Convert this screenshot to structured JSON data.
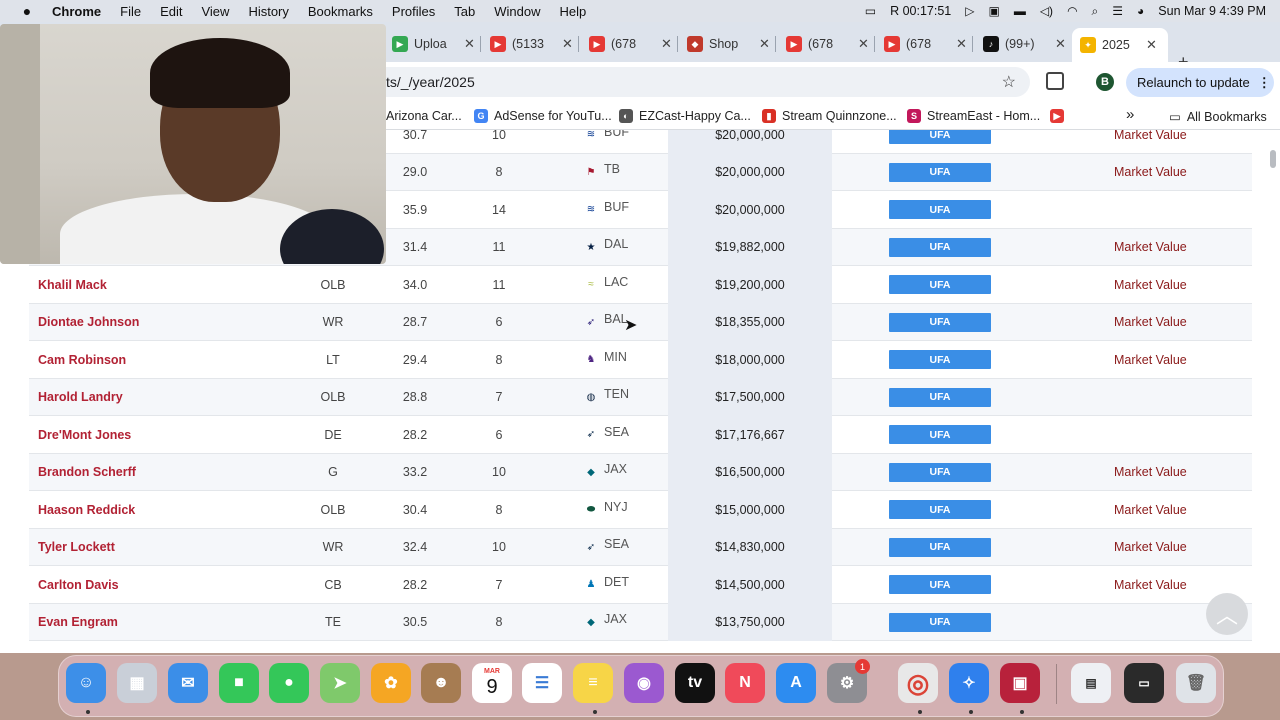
{
  "menubar": {
    "apple": "",
    "items": [
      "Chrome",
      "File",
      "Edit",
      "View",
      "History",
      "Bookmarks",
      "Profiles",
      "Tab",
      "Window",
      "Help"
    ],
    "recording": "R 00:17:51",
    "datetime": "Sun Mar 9  4:39 PM"
  },
  "tabs": [
    {
      "title": "Uploa",
      "favicon_color": "#34a853",
      "favicon": "▶"
    },
    {
      "title": "(5133",
      "favicon_color": "#e53935",
      "favicon": "▶"
    },
    {
      "title": "(678",
      "favicon_color": "#e53935",
      "favicon": "▶"
    },
    {
      "title": "Shop",
      "favicon_color": "#c0392b",
      "favicon": "◆"
    },
    {
      "title": "(678",
      "favicon_color": "#e53935",
      "favicon": "▶"
    },
    {
      "title": "(678",
      "favicon_color": "#e53935",
      "favicon": "▶"
    },
    {
      "title": "(99+)",
      "favicon_color": "#111111",
      "favicon": "♪"
    },
    {
      "title": "2025",
      "favicon_color": "#f4b400",
      "favicon": "✦",
      "active": true
    }
  ],
  "toolbar": {
    "url": "ts/_/year/2025",
    "relaunch_label": "Relaunch to update",
    "profile_initial": "B"
  },
  "bookmarks": [
    {
      "label": "Arizona Car...",
      "color": "#ffffff"
    },
    {
      "label": "AdSense for YouTu...",
      "color": "#4285f4",
      "glyph": "G"
    },
    {
      "label": "EZCast-Happy Ca...",
      "color": "#555555",
      "glyph": "◐"
    },
    {
      "label": "Stream Quinnzone...",
      "color": "#d93025",
      "glyph": "▮"
    },
    {
      "label": "StreamEast - Hom...",
      "color": "#c2185b",
      "glyph": "S"
    },
    {
      "label": "",
      "color": "#e53935",
      "glyph": "▶"
    }
  ],
  "bookmarks_overflow": "»",
  "all_bookmarks_label": "All Bookmarks",
  "table": {
    "rows": [
      {
        "name": "",
        "pos": "",
        "age": "30.7",
        "exp": "10",
        "team": "BUF",
        "team_glyph": "≋",
        "team_color": "#00338d",
        "salary": "$20,000,000",
        "status": "UFA",
        "note": "Market Value"
      },
      {
        "name": "",
        "pos": "",
        "age": "29.0",
        "exp": "8",
        "team": "TB",
        "team_glyph": "⚑",
        "team_color": "#a71930",
        "salary": "$20,000,000",
        "status": "UFA",
        "note": "Market Value"
      },
      {
        "name": "",
        "pos": "",
        "age": "35.9",
        "exp": "14",
        "team": "BUF",
        "team_glyph": "≋",
        "team_color": "#00338d",
        "salary": "$20,000,000",
        "status": "UFA",
        "note": ""
      },
      {
        "name": "",
        "pos": "",
        "age": "31.4",
        "exp": "11",
        "team": "DAL",
        "team_glyph": "★",
        "team_color": "#041e42",
        "salary": "$19,882,000",
        "status": "UFA",
        "note": "Market Value"
      },
      {
        "name": "Khalil Mack",
        "pos": "OLB",
        "age": "34.0",
        "exp": "11",
        "team": "LAC",
        "team_glyph": "≈",
        "team_color": "#a5b838",
        "salary": "$19,200,000",
        "status": "UFA",
        "note": "Market Value"
      },
      {
        "name": "Diontae Johnson",
        "pos": "WR",
        "age": "28.7",
        "exp": "6",
        "team": "BAL",
        "team_glyph": "➶",
        "team_color": "#241773",
        "salary": "$18,355,000",
        "status": "UFA",
        "note": "Market Value"
      },
      {
        "name": "Cam Robinson",
        "pos": "LT",
        "age": "29.4",
        "exp": "8",
        "team": "MIN",
        "team_glyph": "♞",
        "team_color": "#4f2683",
        "salary": "$18,000,000",
        "status": "UFA",
        "note": "Market Value"
      },
      {
        "name": "Harold Landry",
        "pos": "OLB",
        "age": "28.8",
        "exp": "7",
        "team": "TEN",
        "team_glyph": "◍",
        "team_color": "#0c2340",
        "salary": "$17,500,000",
        "status": "UFA",
        "note": ""
      },
      {
        "name": "Dre'Mont Jones",
        "pos": "DE",
        "age": "28.2",
        "exp": "6",
        "team": "SEA",
        "team_glyph": "➶",
        "team_color": "#002244",
        "salary": "$17,176,667",
        "status": "UFA",
        "note": ""
      },
      {
        "name": "Brandon Scherff",
        "pos": "G",
        "age": "33.2",
        "exp": "10",
        "team": "JAX",
        "team_glyph": "◆",
        "team_color": "#006778",
        "salary": "$16,500,000",
        "status": "UFA",
        "note": "Market Value"
      },
      {
        "name": "Haason Reddick",
        "pos": "OLB",
        "age": "30.4",
        "exp": "8",
        "team": "NYJ",
        "team_glyph": "⬬",
        "team_color": "#125740",
        "salary": "$15,000,000",
        "status": "UFA",
        "note": "Market Value"
      },
      {
        "name": "Tyler Lockett",
        "pos": "WR",
        "age": "32.4",
        "exp": "10",
        "team": "SEA",
        "team_glyph": "➶",
        "team_color": "#002244",
        "salary": "$14,830,000",
        "status": "UFA",
        "note": "Market Value"
      },
      {
        "name": "Carlton Davis",
        "pos": "CB",
        "age": "28.2",
        "exp": "7",
        "team": "DET",
        "team_glyph": "♟",
        "team_color": "#0076b6",
        "salary": "$14,500,000",
        "status": "UFA",
        "note": "Market Value"
      },
      {
        "name": "Evan Engram",
        "pos": "TE",
        "age": "30.5",
        "exp": "8",
        "team": "JAX",
        "team_glyph": "◆",
        "team_color": "#006778",
        "salary": "$13,750,000",
        "status": "UFA",
        "note": ""
      }
    ]
  },
  "calendar_month": "MAR",
  "calendar_day": "9",
  "dock": [
    {
      "name": "finder-icon",
      "color": "#3d8fe8",
      "glyph": "☺"
    },
    {
      "name": "launchpad-icon",
      "color": "#c9cfd8",
      "glyph": "▦"
    },
    {
      "name": "mail-icon",
      "color": "#3b8ee8",
      "glyph": "✉"
    },
    {
      "name": "facetime-icon",
      "color": "#34c759",
      "glyph": "■"
    },
    {
      "name": "messages-icon",
      "color": "#34c759",
      "glyph": "●"
    },
    {
      "name": "maps-icon",
      "color": "#7fc96b",
      "glyph": "➤"
    },
    {
      "name": "photos-icon",
      "color": "#f5a623",
      "glyph": "✿"
    },
    {
      "name": "contacts-icon",
      "color": "#a67c52",
      "glyph": "☻"
    },
    {
      "name": "calendar-icon",
      "color": "#ffffff",
      "glyph": ""
    },
    {
      "name": "reminders-icon",
      "color": "#ffffff",
      "glyph": "☰"
    },
    {
      "name": "notes-icon",
      "color": "#f7d547",
      "glyph": "≡"
    },
    {
      "name": "podcasts-icon",
      "color": "#9b59d0",
      "glyph": "◉"
    },
    {
      "name": "appletv-icon",
      "color": "#111111",
      "glyph": "tv"
    },
    {
      "name": "news-icon",
      "color": "#f04a5a",
      "glyph": "N"
    },
    {
      "name": "appstore-icon",
      "color": "#2d8cf0",
      "glyph": "A"
    },
    {
      "name": "settings-icon",
      "color": "#8e8e93",
      "glyph": "⚙"
    },
    {
      "name": "chrome-icon",
      "color": "#e8e8e8",
      "glyph": "◎"
    },
    {
      "name": "safari-icon",
      "color": "#2f80ed",
      "glyph": "✧"
    },
    {
      "name": "screen-recorder-icon",
      "color": "#b8213b",
      "glyph": "▣"
    }
  ],
  "settings_badge": "1"
}
